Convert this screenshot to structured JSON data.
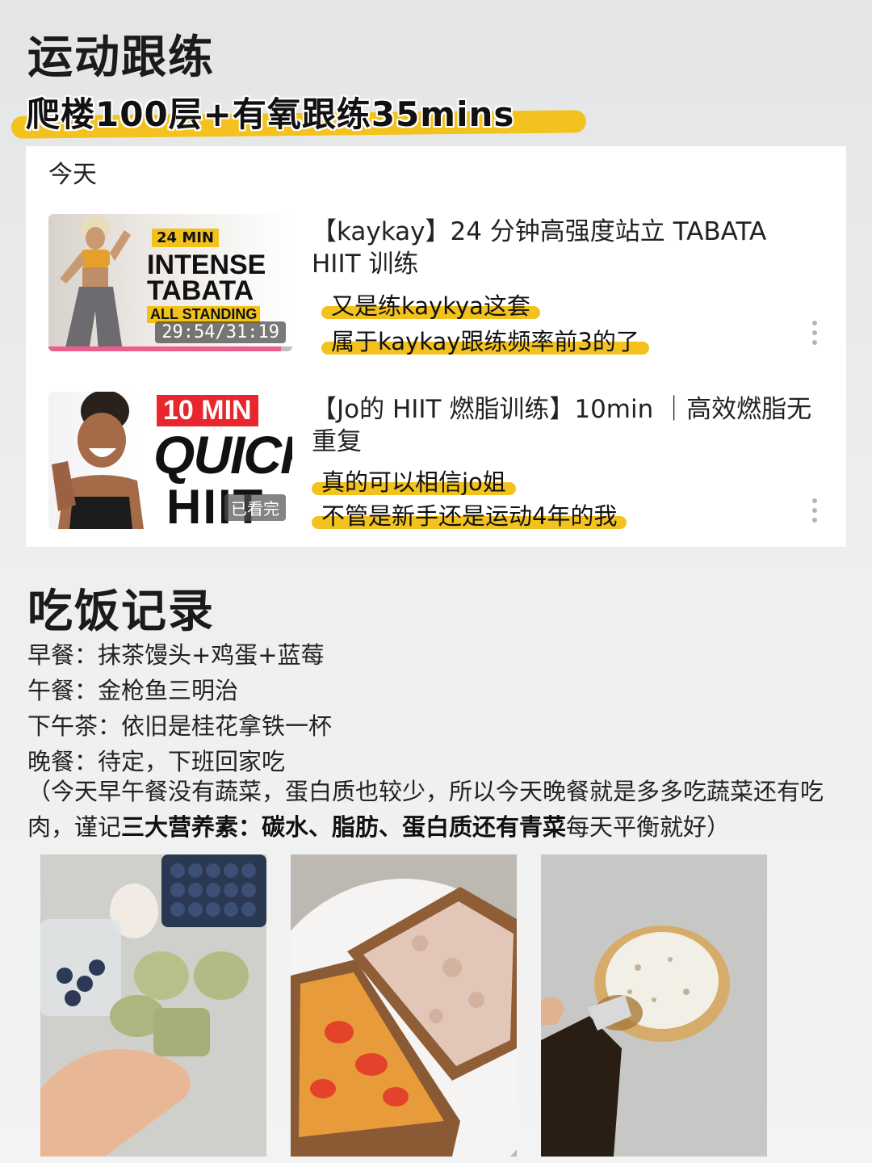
{
  "header": {
    "title": "运动跟练",
    "subtitle": "爬楼100层+有氧跟练35mins"
  },
  "workout_card": {
    "day_label": "今天",
    "videos": [
      {
        "thumb_tag": "24 MIN",
        "thumb_line1": "INTENSE",
        "thumb_line2": "TABATA",
        "thumb_line3": "ALL STANDING",
        "time": "29:54/31:19",
        "progress": 0.955,
        "title": "【kaykay】24 分钟高强度站立 TABATA HIIT 训练",
        "note1": "又是练kaykya这套",
        "note2": "属于kaykay跟练频率前3的了"
      },
      {
        "thumb_tag": "10 MIN",
        "thumb_line1": "QUICK",
        "thumb_line2": "HIIT",
        "watched": "已看完",
        "title": "【Jo的 HIIT 燃脂训练】10min ｜高效燃脂无重复",
        "note1": "真的可以相信jo姐",
        "note2": "不管是新手还是运动4年的我"
      }
    ]
  },
  "meals": {
    "title": "吃饭记录",
    "breakfast": "早餐：抹茶馒头+鸡蛋+蓝莓",
    "lunch": "午餐：金枪鱼三明治",
    "tea": "下午茶：依旧是桂花拿铁一杯",
    "dinner": "晚餐：待定，下班回家吃",
    "note_start": "（今天早午餐没有蔬菜，蛋白质也较少，所以今天晚餐就是多多吃蔬菜还有吃肉，谨记",
    "note_bold": "三大营养素：碳水、脂肪、蛋白质还有青菜",
    "note_end": "每天平衡就好）"
  },
  "colors": {
    "highlight": "#f4c21e",
    "progress": "#ef5d8d",
    "badge_red": "#e8262e"
  },
  "icons": [
    "more-vertical-icon"
  ]
}
